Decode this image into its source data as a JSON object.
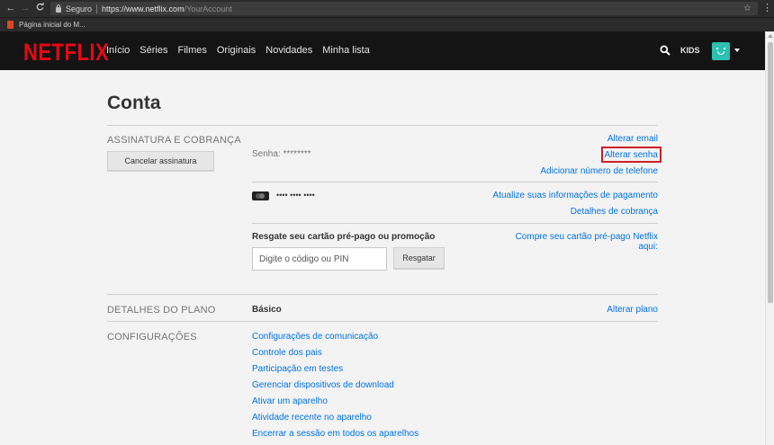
{
  "browser": {
    "back": "←",
    "forward": "→",
    "reload": "C",
    "secure_label": "Seguro",
    "url_host": "https://www.netflix.com",
    "url_path": "/YourAccount",
    "bookmark": "Página inicial do M..."
  },
  "header": {
    "logo": "NETFLIX",
    "nav": [
      "Início",
      "Séries",
      "Filmes",
      "Originais",
      "Novidades",
      "Minha lista"
    ],
    "kids": "KIDS",
    "accent": "#e50914"
  },
  "account": {
    "title": "Conta",
    "membership": {
      "label": "ASSINATURA E COBRANÇA",
      "cancel_button": "Cancelar assinatura",
      "password_label": "Senha: ********",
      "change_email": "Alterar email",
      "change_password": "Alterar senha",
      "add_phone": "Adicionar número de telefone",
      "card_number": "•••• •••• ••••",
      "update_payment": "Atualize suas informações de pagamento",
      "billing_details": "Detalhes de cobrança",
      "gift_heading": "Resgate seu cartão pré-pago ou promoção",
      "gift_placeholder": "Digite o código ou PIN",
      "redeem_button": "Resgatar",
      "buy_gift_line1": "Compre seu cartão pré-pago Netflix",
      "buy_gift_line2": "aqui:"
    },
    "plan": {
      "label": "DETALHES DO PLANO",
      "value": "Básico",
      "change": "Alterar plano"
    },
    "settings": {
      "label": "CONFIGURAÇÕES",
      "items": [
        "Configurações de comunicação",
        "Controle dos pais",
        "Participação em testes",
        "Gerenciar dispositivos de download",
        "Ativar um aparelho",
        "Atividade recente no aparelho",
        "Encerrar a sessão em todos os aparelhos"
      ]
    }
  },
  "colors": {
    "link": "#0073e6",
    "highlight": "#cc1f2a"
  }
}
